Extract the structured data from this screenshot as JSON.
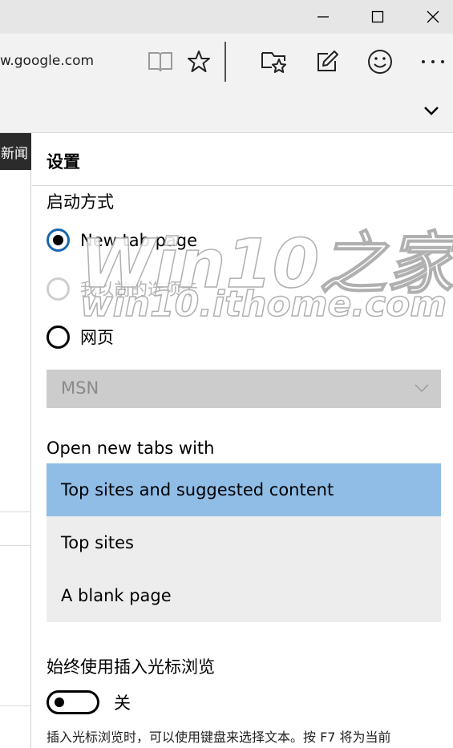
{
  "window": {
    "minimize_icon": "minimize-icon",
    "maximize_icon": "maximize-icon",
    "close_icon": "close-icon"
  },
  "toolbar": {
    "address": "w.google.com",
    "icons": [
      "reading-view-icon",
      "favorite-star-icon",
      "hub-icon",
      "web-note-icon",
      "feedback-smiley-icon",
      "more-icon"
    ]
  },
  "page": {
    "news_tab": "新闻"
  },
  "settings": {
    "title": "设置",
    "startup": {
      "label": "启动方式",
      "options": [
        {
          "label": "New tab page",
          "checked": true,
          "disabled": false
        },
        {
          "label": "我以前的选项卡",
          "checked": false,
          "disabled": true
        },
        {
          "label": "网页",
          "checked": false,
          "disabled": false
        }
      ],
      "select_value": "MSN"
    },
    "new_tabs": {
      "label": "Open new tabs with",
      "options": [
        "Top sites and suggested content",
        "Top sites",
        "A blank page"
      ],
      "selected_index": 0,
      "selected_color": "#8fbde6"
    },
    "caret_browsing": {
      "label": "始终使用插入光标浏览",
      "toggle_state": "关",
      "description": "插入光标浏览时，可以使用键盘来选择文本。按 F7 将为当前"
    }
  },
  "watermark": {
    "line1": "Win10之家",
    "line2": "win10.ithome.com"
  }
}
